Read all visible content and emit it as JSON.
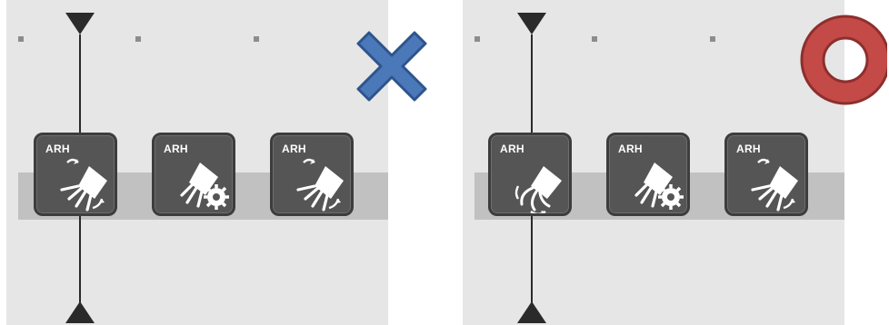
{
  "left_panel": {
    "clips": [
      {
        "label": "ARH",
        "icon": "robot-hand-grab-rotate-icon"
      },
      {
        "label": "ARH",
        "icon": "robot-hand-settings-icon"
      },
      {
        "label": "ARH",
        "icon": "robot-hand-grab-rotate-icon"
      }
    ],
    "verdict": {
      "icon": "cross-mark-icon",
      "color": "#4a78b8"
    }
  },
  "right_panel": {
    "clips": [
      {
        "label": "ARH",
        "icon": "robot-hand-release-rotate-icon"
      },
      {
        "label": "ARH",
        "icon": "robot-hand-settings-icon"
      },
      {
        "label": "ARH",
        "icon": "robot-hand-grab-rotate-icon"
      }
    ],
    "verdict": {
      "icon": "circle-mark-icon",
      "color": "#c44a47"
    }
  }
}
